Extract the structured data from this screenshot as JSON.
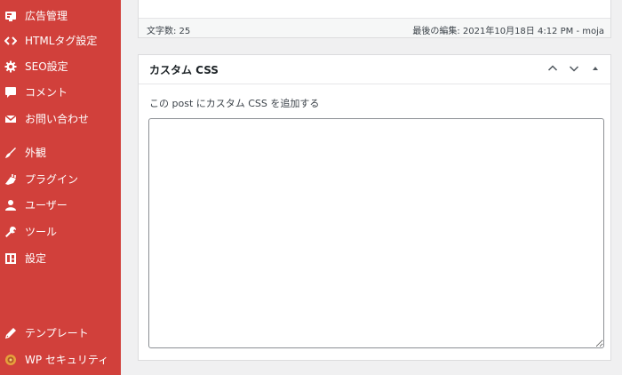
{
  "sidebar": {
    "items": [
      {
        "id": "ads",
        "label": "広告管理",
        "icon": "ad-icon"
      },
      {
        "id": "html-tag",
        "label": "HTMLタグ設定",
        "icon": "code-icon"
      },
      {
        "id": "seo",
        "label": "SEO設定",
        "icon": "gear-icon"
      },
      {
        "id": "comments",
        "label": "コメント",
        "icon": "comment-icon"
      },
      {
        "id": "contact",
        "label": "お問い合わせ",
        "icon": "mail-icon"
      },
      {
        "id": "appearance",
        "label": "外観",
        "icon": "brush-icon"
      },
      {
        "id": "plugins",
        "label": "プラグイン",
        "icon": "plugin-icon"
      },
      {
        "id": "users",
        "label": "ユーザー",
        "icon": "user-icon"
      },
      {
        "id": "tools",
        "label": "ツール",
        "icon": "wrench-icon"
      },
      {
        "id": "settings",
        "label": "設定",
        "icon": "settings-icon"
      },
      {
        "id": "templates",
        "label": "テンプレート",
        "icon": "pencil-icon"
      },
      {
        "id": "wp-security",
        "label": "WP セキュリティ",
        "icon": "shield-icon"
      }
    ]
  },
  "editor_status": {
    "word_count": "文字数: 25",
    "last_edited": "最後の編集: 2021年10月18日 4:12 PM - moja"
  },
  "custom_css": {
    "title": "カスタム CSS",
    "description": "この post にカスタム CSS を追加する",
    "textarea_value": ""
  }
}
